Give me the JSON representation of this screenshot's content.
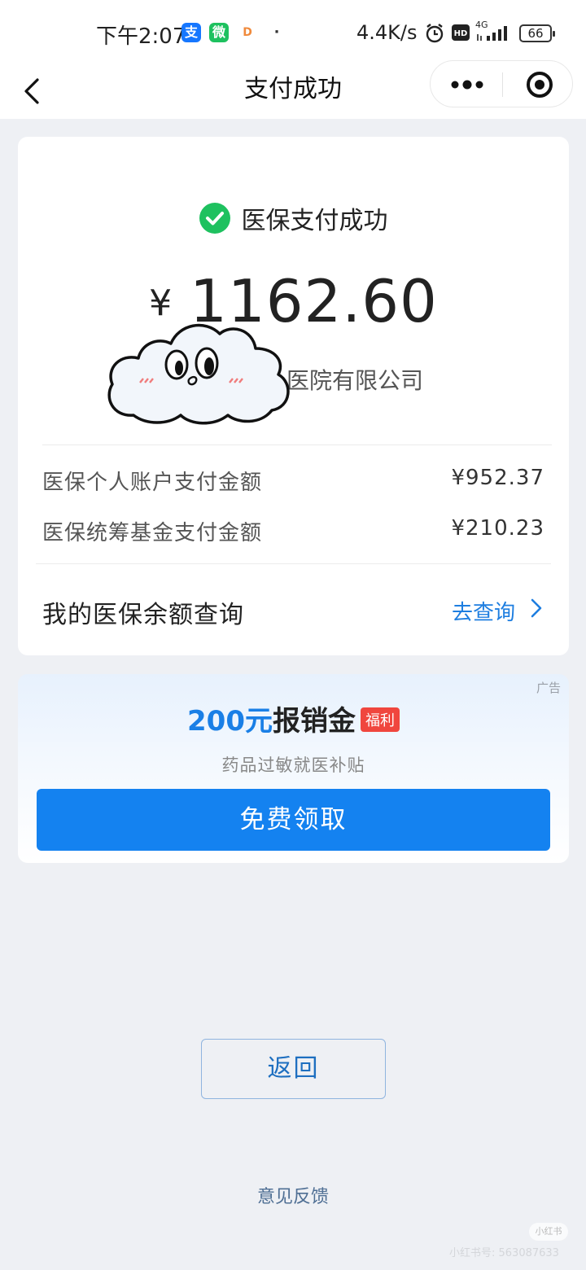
{
  "status_bar": {
    "time": "下午2:07",
    "apps": [
      "支",
      "微",
      "D",
      "·"
    ],
    "net_speed": "4.4K/s",
    "network": "4G",
    "battery": "66"
  },
  "nav": {
    "title": "支付成功"
  },
  "payment": {
    "status_text": "医保支付成功",
    "currency": "¥",
    "amount": "1162.60",
    "merchant_suffix": "医院有限公司"
  },
  "details": [
    {
      "label": "医保个人账户支付金额",
      "value": "¥952.37"
    },
    {
      "label": "医保统筹基金支付金额",
      "value": "¥210.23"
    }
  ],
  "balance_query": {
    "label": "我的医保余额查询",
    "link": "去查询"
  },
  "ad": {
    "tag": "广告",
    "amount": "200元",
    "title": "报销金",
    "badge": "福利",
    "subtitle": "药品过敏就医补贴",
    "button": "免费领取"
  },
  "footer": {
    "return_button": "返回",
    "feedback": "意见反馈",
    "watermark_logo": "小红书",
    "watermark_text": "小红书号: 563087633"
  },
  "colors": {
    "success_green": "#1ec15f",
    "primary_blue": "#1482f0",
    "link_blue": "#1e7ee0",
    "badge_red": "#f0463e",
    "background": "#eef0f4"
  },
  "icons": [
    "back-arrow-icon",
    "more-dots-icon",
    "close-target-icon",
    "check-circle-icon",
    "chevron-right-icon",
    "cloud-sticker-icon"
  ]
}
